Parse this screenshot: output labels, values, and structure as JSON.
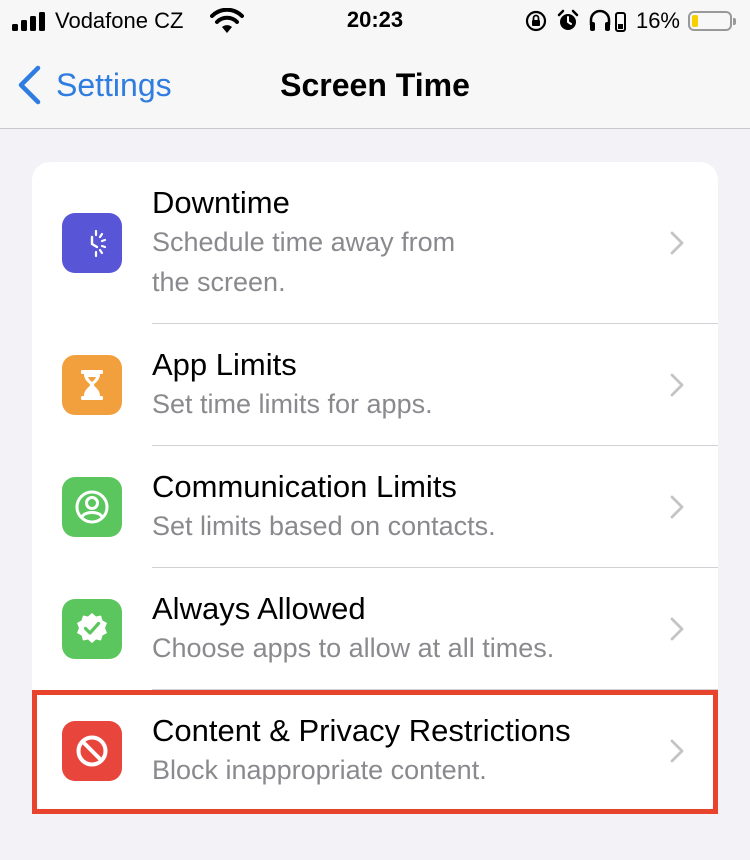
{
  "status_bar": {
    "carrier": "Vodafone CZ",
    "time": "20:23",
    "battery_percent": "16%",
    "battery_level": 0.16,
    "icons": [
      "signal-icon",
      "wifi-icon",
      "rotation-lock-icon",
      "alarm-icon",
      "headphones-icon",
      "battery-icon"
    ]
  },
  "nav": {
    "back_label": "Settings",
    "title": "Screen Time"
  },
  "rows": [
    {
      "title": "Downtime",
      "subtitle": "Schedule time away from\nthe screen.",
      "icon": "downtime-icon",
      "color": "#5856d6"
    },
    {
      "title": "App Limits",
      "subtitle": "Set time limits for apps.",
      "icon": "hourglass-icon",
      "color": "#f2a03d"
    },
    {
      "title": "Communication Limits",
      "subtitle": "Set limits based on contacts.",
      "icon": "person-circle-icon",
      "color": "#5cc65e"
    },
    {
      "title": "Always Allowed",
      "subtitle": "Choose apps to allow at all times.",
      "icon": "checkmark-seal-icon",
      "color": "#5cc65e"
    },
    {
      "title": "Content & Privacy Restrictions",
      "subtitle": "Block inappropriate content.",
      "icon": "restriction-icon",
      "color": "#e8463c"
    }
  ],
  "highlight_color": "#e8432d"
}
